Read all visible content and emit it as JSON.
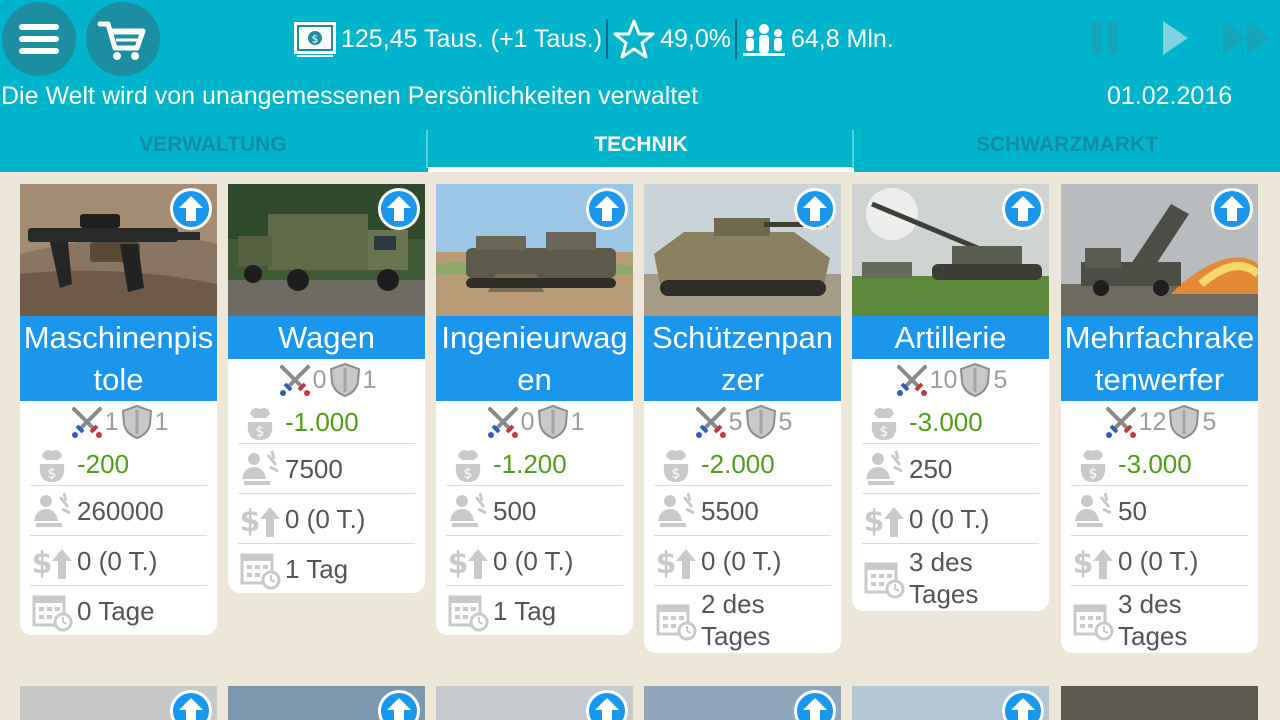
{
  "header": {
    "money": "125,45 Taus. (+1 Taus.)",
    "rating": "49,0%",
    "population": "64,8 Mln.",
    "subtitle": "Die Welt wird von unangemessenen Persönlichkeiten verwaltet",
    "date": "01.02.2016"
  },
  "tabs": [
    {
      "label": "VERWALTUNG",
      "active": false
    },
    {
      "label": "TECHNIK",
      "active": true
    },
    {
      "label": "SCHWARZMARKT",
      "active": false
    }
  ],
  "cards": [
    {
      "title": "Maschinenpistole",
      "attack": "1",
      "defense": "1",
      "cost": "-200",
      "personnel": "260000",
      "income": "0 (0 T.)",
      "time": "0 Tage",
      "image": "rifle"
    },
    {
      "title": "Wagen",
      "attack": "0",
      "defense": "1",
      "cost": "-1.000",
      "personnel": "7500",
      "income": "0 (0 T.)",
      "time": "1 Tag",
      "image": "truck"
    },
    {
      "title": "Ingenieurwagen",
      "attack": "0",
      "defense": "1",
      "cost": "-1.200",
      "personnel": "500",
      "income": "0 (0 T.)",
      "time": "1 Tag",
      "image": "engineer"
    },
    {
      "title": "Schützenpanzer",
      "attack": "5",
      "defense": "5",
      "cost": "-2.000",
      "personnel": "5500",
      "income": "0 (0 T.)",
      "time": "2 des Tages",
      "image": "ifv"
    },
    {
      "title": "Artillerie",
      "attack": "10",
      "defense": "5",
      "cost": "-3.000",
      "personnel": "250",
      "income": "0 (0 T.)",
      "time": "3 des Tages",
      "image": "artillery"
    },
    {
      "title": "Mehrfachraketenwerfer",
      "attack": "12",
      "defense": "5",
      "cost": "-3.000",
      "personnel": "50",
      "income": "0 (0 T.)",
      "time": "3 des Tages",
      "image": "rocket"
    }
  ],
  "colors": {
    "primary": "#00b4cc",
    "accent": "#1a96ec",
    "cost": "#4e9f18",
    "background": "#ece7d8"
  },
  "icons": [
    "menu-icon",
    "cart-icon",
    "money-icon",
    "star-icon",
    "population-icon",
    "pause-icon",
    "play-icon",
    "fast-forward-icon",
    "upgrade-arrow-icon",
    "swords-icon",
    "shield-icon",
    "money-bag-icon",
    "personnel-icon",
    "income-icon",
    "calendar-icon"
  ]
}
